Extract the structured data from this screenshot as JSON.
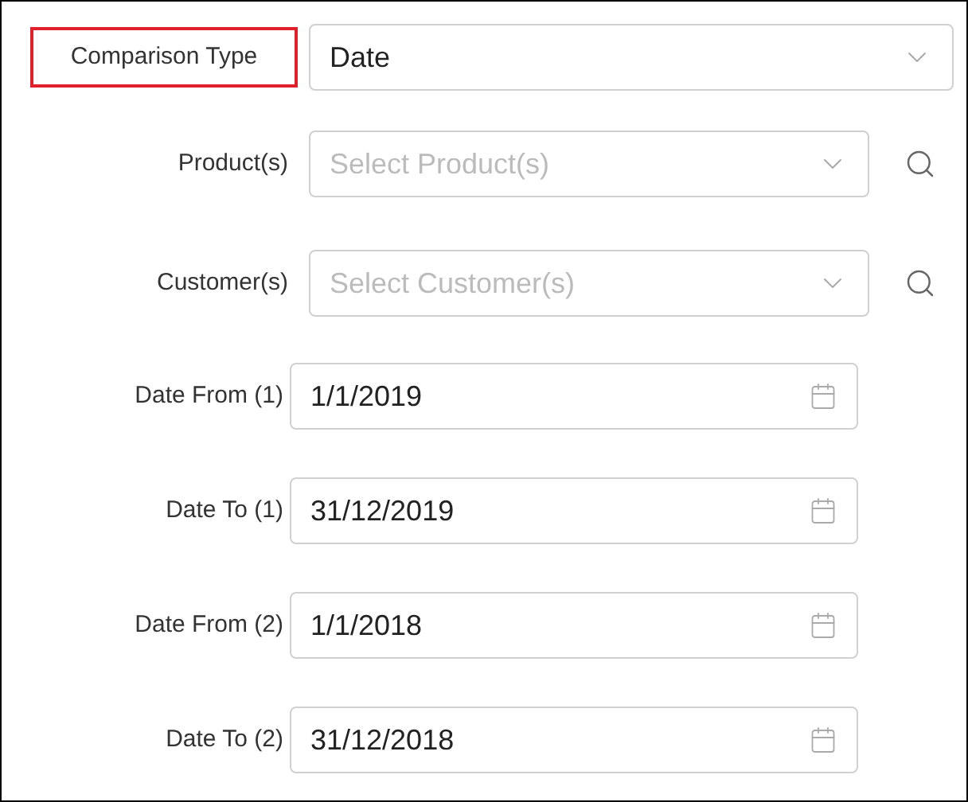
{
  "comparison_type": {
    "label": "Comparison Type",
    "value": "Date",
    "highlighted": true
  },
  "selectors": [
    {
      "label": "Product(s)",
      "placeholder": "Select Product(s)"
    },
    {
      "label": "Customer(s)",
      "placeholder": "Select Customer(s)"
    }
  ],
  "dates": [
    {
      "label": "Date From (1)",
      "value": "1/1/2019"
    },
    {
      "label": "Date To (1)",
      "value": "31/12/2019"
    },
    {
      "label": "Date From (2)",
      "value": "1/1/2018"
    },
    {
      "label": "Date To (2)",
      "value": "31/12/2018"
    }
  ]
}
